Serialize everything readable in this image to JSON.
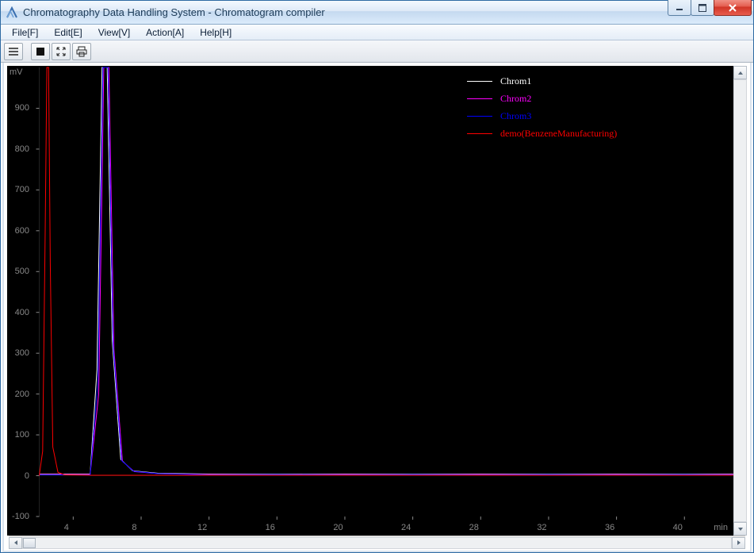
{
  "window": {
    "title": "Chromatography Data Handling System - Chromatogram compiler"
  },
  "menu": {
    "items": [
      "File[F]",
      "Edit[E]",
      "View[V]",
      "Action[A]",
      "Help[H]"
    ]
  },
  "toolbar": {
    "btn1": "hamburger-icon",
    "btn2": "stop-icon",
    "btn3": "expand-icon",
    "btn4": "print-icon"
  },
  "chart_data": {
    "type": "line",
    "xlabel": "min",
    "ylabel": "mV",
    "xlim": [
      2,
      43
    ],
    "ylim": [
      -100,
      1000
    ],
    "x_ticks": [
      4,
      8,
      12,
      16,
      20,
      24,
      28,
      32,
      36,
      40
    ],
    "y_ticks": [
      -100,
      0,
      100,
      200,
      300,
      400,
      500,
      600,
      700,
      800,
      900
    ],
    "legend": [
      {
        "name": "Chrom1",
        "color": "#ffffff"
      },
      {
        "name": "Chrom2",
        "color": "#ff00ff"
      },
      {
        "name": "Chrom3",
        "color": "#0000ff"
      },
      {
        "name": "demo(BenzeneManufacturing)",
        "color": "#ff0000"
      }
    ],
    "series": [
      {
        "name": "Chrom1",
        "color": "#ffffff",
        "x": [
          2.0,
          5.0,
          5.4,
          5.7,
          6.0,
          6.3,
          6.8,
          7.5,
          9.0,
          12,
          16,
          20,
          24,
          28,
          32,
          36,
          40,
          43
        ],
        "y": [
          4,
          4,
          260,
          1000,
          1000,
          330,
          40,
          12,
          6,
          4,
          4,
          4,
          4,
          4,
          4,
          4,
          4,
          4
        ]
      },
      {
        "name": "Chrom2",
        "color": "#ff00ff",
        "x": [
          2.0,
          5.0,
          5.5,
          5.8,
          6.1,
          6.4,
          6.9,
          7.6,
          9.0,
          12,
          16,
          20,
          24,
          28,
          32,
          36,
          40,
          43
        ],
        "y": [
          3,
          3,
          200,
          1000,
          1000,
          310,
          35,
          10,
          5,
          3,
          3,
          3,
          3,
          3,
          3,
          3,
          3,
          3
        ]
      },
      {
        "name": "Chrom3",
        "color": "#0000ff",
        "x": [
          2.0,
          5.0,
          5.45,
          5.75,
          6.05,
          6.35,
          6.85,
          7.55,
          9.0,
          12,
          16,
          20,
          24,
          28,
          32,
          36,
          40,
          43
        ],
        "y": [
          2,
          2,
          230,
          1000,
          1000,
          320,
          37,
          11,
          5,
          2,
          3,
          2,
          3,
          2,
          3,
          2,
          3,
          2
        ]
      },
      {
        "name": "demo(BenzeneManufacturing)",
        "color": "#ff0000",
        "x": [
          2.0,
          2.2,
          2.35,
          2.45,
          2.55,
          2.65,
          2.8,
          3.1,
          3.5,
          5.0,
          10,
          20,
          43
        ],
        "y": [
          0,
          60,
          600,
          1000,
          1000,
          520,
          70,
          8,
          2,
          1,
          1,
          1,
          1
        ]
      }
    ]
  }
}
